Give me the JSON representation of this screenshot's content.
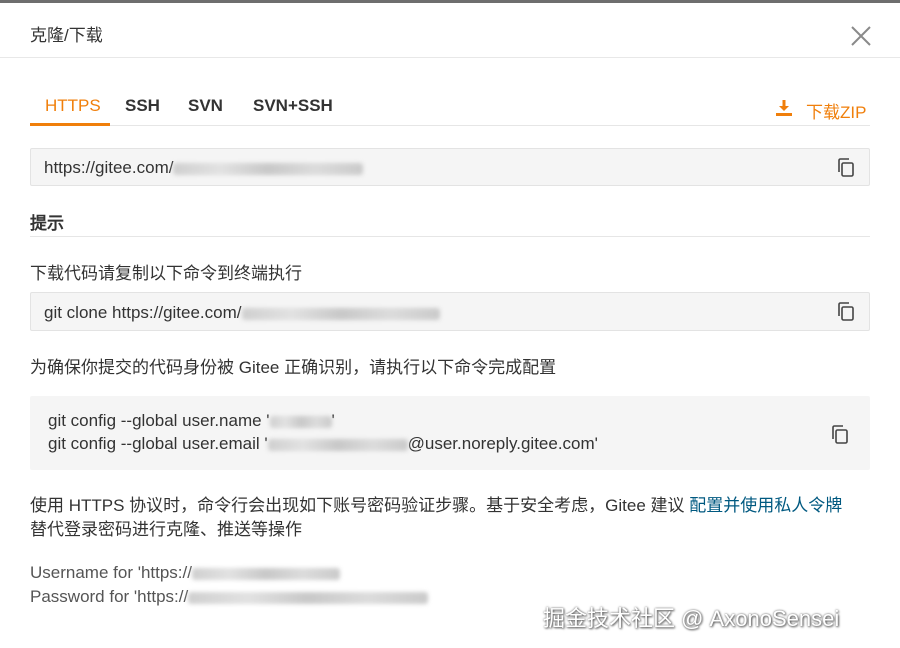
{
  "dialog": {
    "title": "克隆/下载"
  },
  "tabs": [
    {
      "label": "HTTPS",
      "active": true
    },
    {
      "label": "SSH",
      "active": false
    },
    {
      "label": "SVN",
      "active": false
    },
    {
      "label": "SVN+SSH",
      "active": false
    }
  ],
  "download": {
    "label": "下载ZIP",
    "icon": "download-icon"
  },
  "clone_url": {
    "prefix": "https://gitee.com/"
  },
  "hint": {
    "title": "提示",
    "instruction": "下载代码请复制以下命令到终端执行",
    "clone_command_prefix": "git clone https://gitee.com/",
    "identity_instruction": "为确保你提交的代码身份被 Gitee 正确识别，请执行以下命令完成配置",
    "config_name_prefix": "git config --global user.name '",
    "config_name_suffix": "'",
    "config_email_prefix": "git config --global user.email '",
    "config_email_suffix": "@user.noreply.gitee.com'",
    "https_note": "使用 HTTPS 协议时，命令行会出现如下账号密码验证步骤。基于安全考虑，Gitee 建议",
    "https_note_link": "配置并使用私人令牌",
    "https_note_tail": "替代登录密码进行克隆、推送等操作",
    "username_prompt": "Username for 'https://",
    "password_prompt": "Password for 'https://"
  },
  "watermark": "掘金技术社区 @ AxonoSensei",
  "colors": {
    "accent": "#f07f0b",
    "link": "#005980",
    "field_bg": "#f5f5f5"
  }
}
